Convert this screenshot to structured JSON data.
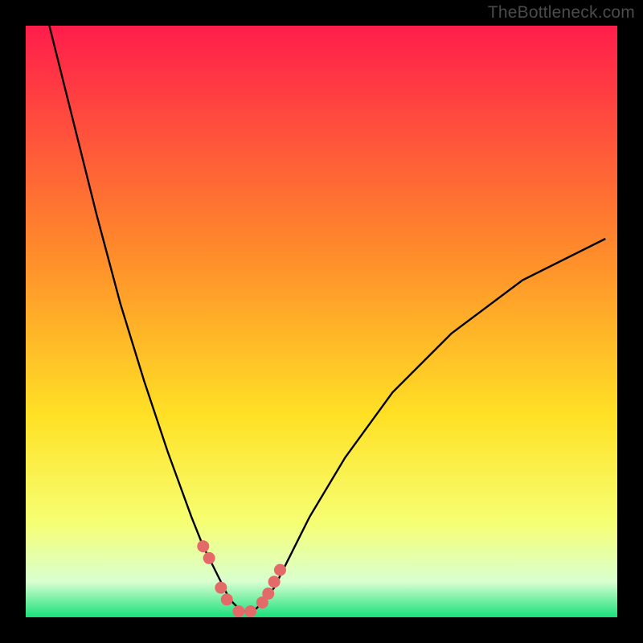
{
  "watermark": "TheBottleneck.com",
  "colors": {
    "top": "#ff1d4b",
    "mid1": "#ff8a2b",
    "mid2": "#ffe125",
    "low1": "#f6ff73",
    "low2": "#d9ffd0",
    "bottom": "#18e07a",
    "curve": "#000000",
    "marker": "#e46a6a"
  },
  "chart_data": {
    "type": "line",
    "title": "",
    "xlabel": "",
    "ylabel": "",
    "xlim": [
      0,
      100
    ],
    "ylim": [
      0,
      100
    ],
    "series": [
      {
        "name": "bottleneck-curve",
        "x": [
          4,
          8,
          12,
          16,
          20,
          24,
          28,
          30,
          32,
          34,
          35,
          36,
          37,
          38,
          39,
          40,
          42,
          44,
          48,
          54,
          62,
          72,
          84,
          98
        ],
        "values": [
          100,
          84,
          68,
          53,
          40,
          28,
          17,
          12,
          8,
          4,
          2.5,
          1.5,
          1,
          1,
          1.5,
          2.5,
          5,
          9,
          17,
          27,
          38,
          48,
          57,
          64
        ]
      }
    ],
    "markers": {
      "name": "highlight-dots",
      "x": [
        30,
        31,
        33,
        34,
        36,
        38,
        40,
        41,
        42,
        43
      ],
      "values": [
        12,
        10,
        5,
        3,
        1,
        1,
        2.5,
        4,
        6,
        8
      ]
    }
  }
}
